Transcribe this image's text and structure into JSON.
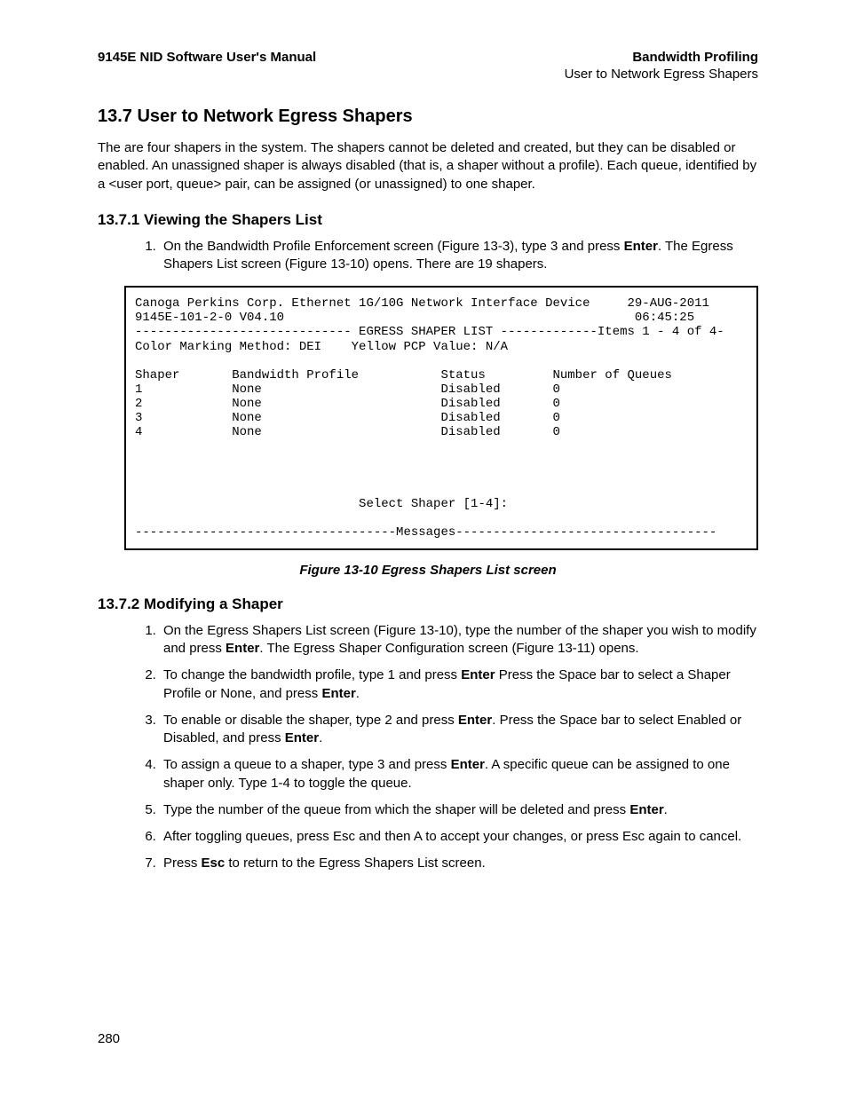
{
  "header": {
    "left": "9145E NID Software User's Manual",
    "right": "Bandwidth Profiling",
    "sub_right": "User to Network Egress Shapers"
  },
  "section": {
    "num_title": "13.7  User to Network Egress Shapers",
    "intro": "The are four shapers in the system. The shapers cannot be deleted and created, but they  can be disabled or enabled. An unassigned shaper is always disabled (that is, a shaper without a profile). Each queue, identified by a <user port, queue> pair, can be assigned (or unassigned) to one shaper."
  },
  "sub1": {
    "title": "13.7.1  Viewing the Shapers List",
    "step1_a": "On the Bandwidth Profile Enforcement screen (Figure 13-3), type 3 and press ",
    "step1_b_bold": "Enter",
    "step1_c": ". The Egress Shapers List screen (Figure 13-10) opens. There are 19 shapers."
  },
  "terminal": {
    "line1": "Canoga Perkins Corp. Ethernet 1G/10G Network Interface Device     29-AUG-2011",
    "line2": "9145E-101-2-0 V04.10                                               06:45:25",
    "line3": "----------------------------- EGRESS SHAPER LIST -------------Items 1 - 4 of 4-",
    "line4": "Color Marking Method: DEI    Yellow PCP Value: N/A",
    "blank": "",
    "hcols": "Shaper       Bandwidth Profile           Status         Number of Queues",
    "r1": "1            None                        Disabled       0",
    "r2": "2            None                        Disabled       0",
    "r3": "3            None                        Disabled       0",
    "r4": "4            None                        Disabled       0",
    "prompt": "                              Select Shaper [1-4]:",
    "msgs": "-----------------------------------Messages-----------------------------------"
  },
  "fig_caption": "Figure 13-10  Egress Shapers List screen",
  "sub2": {
    "title": "13.7.2  Modifying a Shaper",
    "s1a": "On the  Egress Shapers List screen (Figure 13-10), type the number of the shaper you wish to modify and press ",
    "s1b": "Enter",
    "s1c": ". The Egress Shaper Configuration screen (Figure 13-11) opens.",
    "s2a": "To change the bandwidth profile, type 1 and press ",
    "s2b": "Enter",
    "s2c": "  Press the Space bar to select a Shaper Profile or None, and press ",
    "s2d": "Enter",
    "s2e": ".",
    "s3a": "To enable or disable the shaper, type 2 and press ",
    "s3b": "Enter",
    "s3c": ". Press the Space bar to select Enabled or Disabled, and press ",
    "s3d": "Enter",
    "s3e": ".",
    "s4a": "To assign a queue to a shaper, type 3 and press ",
    "s4b": "Enter",
    "s4c": ". A specific queue can be assigned to one shaper only. Type 1-4 to toggle the queue.",
    "s5a": "Type the number of the queue from which the shaper will be deleted and press ",
    "s5b": "Enter",
    "s5c": ".",
    "s6": "After toggling queues, press Esc and then A to accept your changes, or press Esc again to cancel.",
    "s7a": "Press ",
    "s7b": "Esc",
    "s7c": " to return to the Egress Shapers List screen."
  },
  "page_number": "280"
}
